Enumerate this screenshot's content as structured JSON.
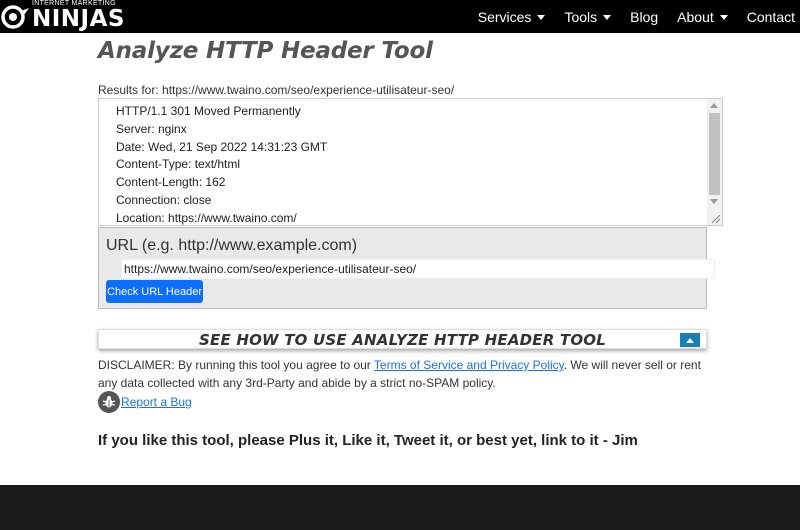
{
  "brand": {
    "top_text": "INTERNET MARKETING",
    "name": "NINJAS"
  },
  "nav": {
    "items": [
      {
        "label": "Services",
        "dropdown": true
      },
      {
        "label": "Tools",
        "dropdown": true
      },
      {
        "label": "Blog",
        "dropdown": false
      },
      {
        "label": "About",
        "dropdown": true
      },
      {
        "label": "Contact",
        "dropdown": false
      }
    ]
  },
  "page": {
    "title": "Analyze HTTP Header Tool",
    "results_label": "Results for: https://www.twaino.com/seo/experience-utilisateur-seo/"
  },
  "results": {
    "lines": [
      "HTTP/1.1 301 Moved Permanently",
      "Server: nginx",
      "Date: Wed, 21 Sep 2022 14:31:23 GMT",
      "Content-Type: text/html",
      "Content-Length: 162",
      "Connection: close",
      "Location: https://www.twaino.com/"
    ]
  },
  "form": {
    "url_label": "URL (e.g. http://www.example.com)",
    "url_value": "https://www.twaino.com/seo/experience-utilisateur-seo/",
    "submit_label": "Check URL Header"
  },
  "howto": {
    "label": "SEE HOW TO USE ANALYZE HTTP HEADER TOOL"
  },
  "disclaimer": {
    "before": "DISCLAIMER: By running this tool you agree to our ",
    "link": "Terms of Service and Privacy Policy",
    "after": ". We will never sell or rent any data collected with any 3rd-Party and abide by a strict no-SPAM policy."
  },
  "bug": {
    "label": "Report a Bug"
  },
  "cta": {
    "text": "If you like this tool, please Plus it, Like it, Tweet it, or best yet, link to it - Jim"
  },
  "colors": {
    "nav_bg": "#000000",
    "button_blue": "#0d6efd",
    "howto_btn": "#1a7fb5",
    "footer_bg": "#1b1b1b"
  }
}
